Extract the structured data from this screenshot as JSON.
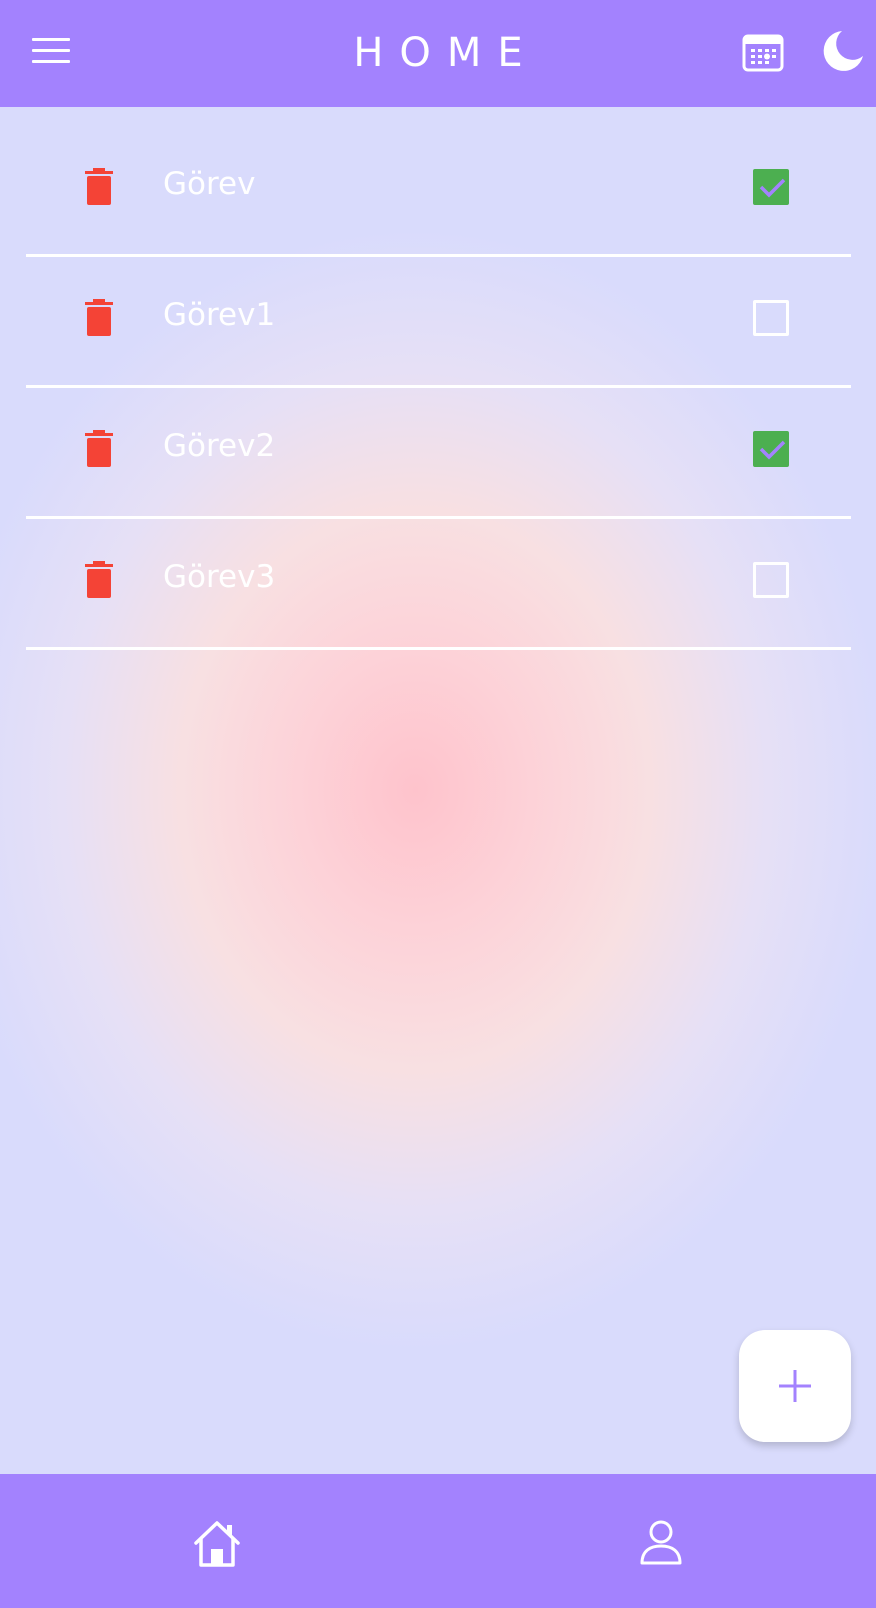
{
  "header": {
    "title": "HOME",
    "menu_icon": "hamburger-menu-icon",
    "calendar_icon": "calendar-icon",
    "theme_icon": "moon-icon"
  },
  "tasks": [
    {
      "label": "Görev",
      "checked": true
    },
    {
      "label": "Görev1",
      "checked": false
    },
    {
      "label": "Görev2",
      "checked": true
    },
    {
      "label": "Görev3",
      "checked": false
    }
  ],
  "fab": {
    "icon": "plus-icon",
    "symbol": "+"
  },
  "bottom_nav": {
    "items": [
      {
        "name": "home",
        "icon": "home-icon"
      },
      {
        "name": "profile",
        "icon": "person-icon"
      }
    ]
  },
  "colors": {
    "app_bar": "#a382fe",
    "trash": "#f44336",
    "check_fill": "#4caf50",
    "check_mark": "#a382fe",
    "text": "#ffffff"
  }
}
